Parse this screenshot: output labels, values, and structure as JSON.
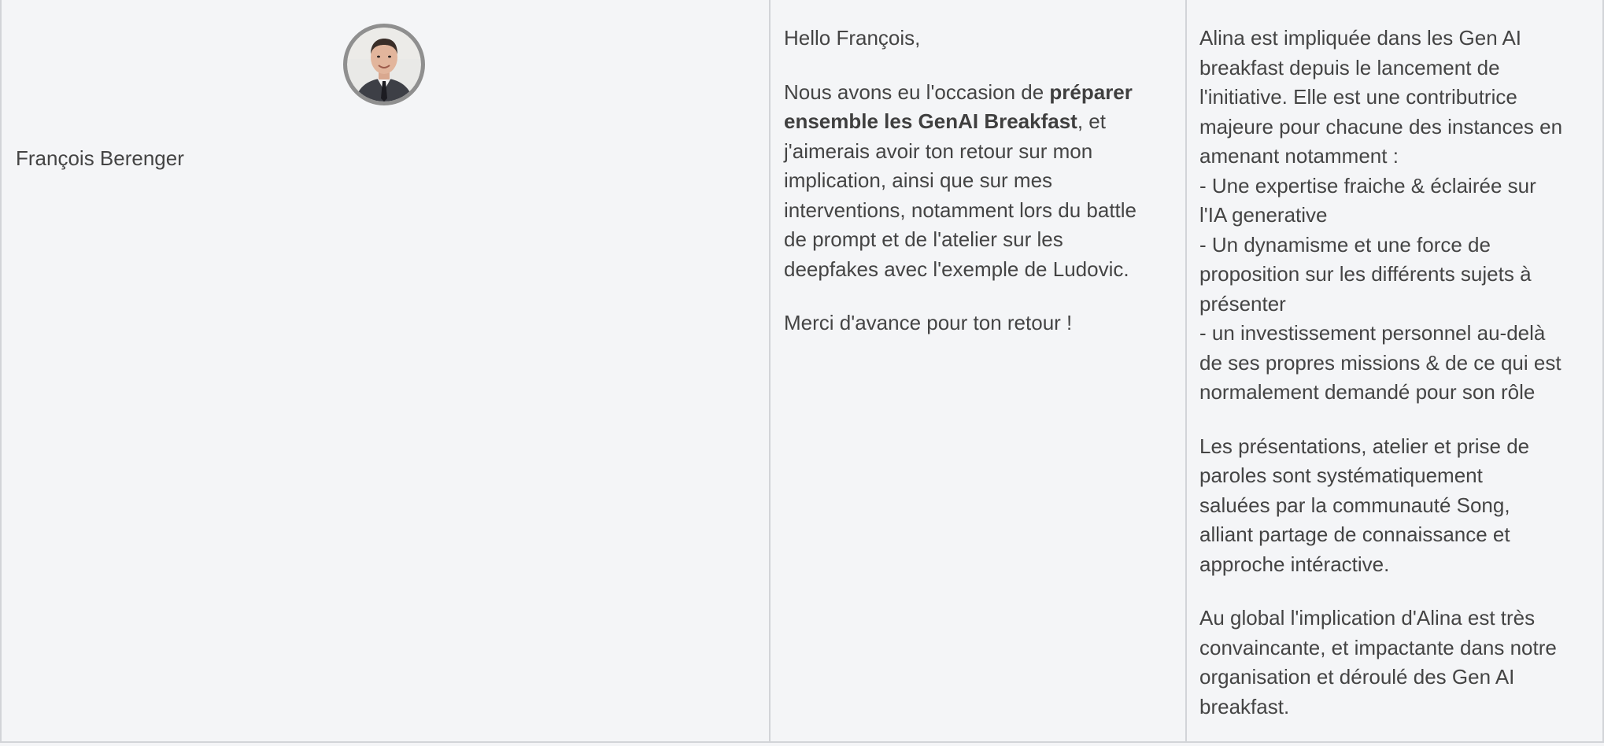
{
  "person": {
    "name": "François Berenger"
  },
  "request": {
    "greeting": "Hello François,",
    "line1_prefix": "Nous avons eu l'occasion de ",
    "line1_bold": "préparer",
    "line2_bold": "ensemble les GenAI Breakfast",
    "line2_suffix": ", et",
    "line3": "j'aimerais avoir ton retour sur mon",
    "line4": "implication, ainsi que sur mes",
    "line5": "interventions, notamment lors du battle",
    "line6": "de prompt et de l'atelier sur les",
    "line7": "deepfakes avec l'exemple de Ludovic.",
    "closing": "Merci d'avance pour ton retour !"
  },
  "feedback": {
    "p1": [
      "Alina est impliquée dans les Gen AI",
      "breakfast depuis le lancement de",
      "l'initiative. Elle est une contributrice",
      "majeure pour chacune des instances en",
      "amenant notamment :",
      "- Une expertise fraiche & éclairée sur",
      "l'IA generative",
      "- Un dynamisme et une force de",
      "proposition sur les différents sujets à",
      "présenter",
      "- un investissement personnel au-delà",
      "de ses propres missions & de ce qui est",
      "normalement demandé pour son rôle"
    ],
    "p2": [
      "Les présentations, atelier et prise de",
      "paroles sont systématiquement",
      "saluées par la communauté Song,",
      "alliant partage de connaissance et",
      "approche intéractive."
    ],
    "p3": [
      "Au global l'implication d'Alina est très",
      "convaincante, et impactante dans notre",
      "organisation et déroulé des Gen AI",
      "breakfast."
    ]
  }
}
